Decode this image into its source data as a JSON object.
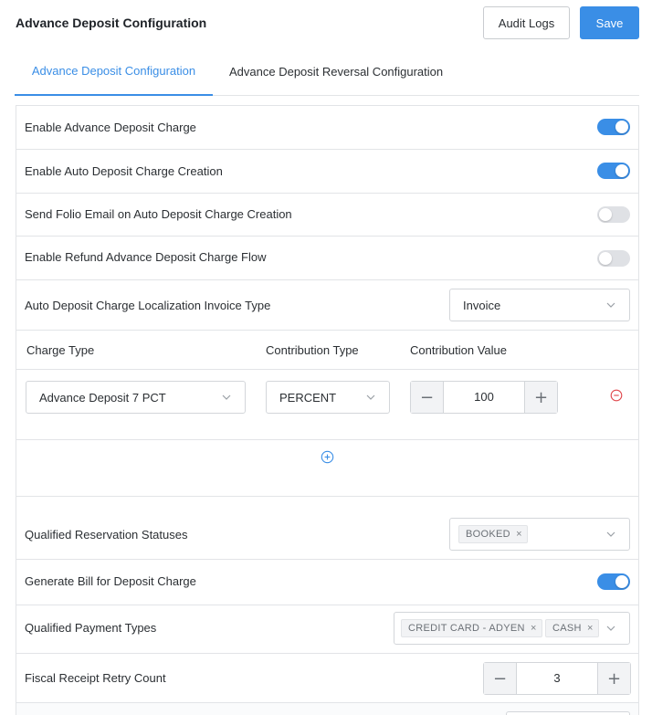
{
  "header": {
    "title": "Advance Deposit Configuration",
    "audit_label": "Audit Logs",
    "save_label": "Save"
  },
  "tabs": [
    {
      "label": "Advance Deposit Configuration",
      "active": true
    },
    {
      "label": "Advance Deposit Reversal Configuration",
      "active": false
    }
  ],
  "settings": {
    "enable_charge": {
      "label": "Enable Advance Deposit Charge",
      "enabled": true
    },
    "auto_creation": {
      "label": "Enable Auto Deposit Charge Creation",
      "enabled": true
    },
    "folio_email": {
      "label": "Send Folio Email on Auto Deposit Charge Creation",
      "enabled": false
    },
    "refund_flow": {
      "label": "Enable Refund Advance Deposit Charge Flow",
      "enabled": false
    },
    "invoice_type": {
      "label": "Auto Deposit Charge Localization Invoice Type",
      "value": "Invoice"
    },
    "reservation_statuses": {
      "label": "Qualified Reservation Statuses",
      "tags": [
        "BOOKED"
      ]
    },
    "generate_bill": {
      "label": "Generate Bill for Deposit Charge",
      "enabled": true
    },
    "payment_types": {
      "label": "Qualified Payment Types",
      "tags": [
        "CREDIT CARD - ADYEN",
        "CASH"
      ]
    },
    "retry_count": {
      "label": "Fiscal Receipt Retry Count",
      "value": "3"
    }
  },
  "charge_table": {
    "headers": {
      "charge_type": "Charge Type",
      "contribution_type": "Contribution Type",
      "contribution_value": "Contribution Value"
    },
    "rows": [
      {
        "charge_type": "Advance Deposit 7 PCT",
        "contribution_type": "PERCENT",
        "contribution_value": "100"
      }
    ]
  },
  "icons": {
    "chevron": "chevron-down-icon",
    "remove": "remove-circle-icon",
    "add": "add-circle-icon",
    "minus": "−",
    "plus": "+",
    "tag_close": "×"
  },
  "colors": {
    "accent": "#3a8ee6",
    "danger": "#e0474c",
    "toggle_off": "#dfe1e5"
  }
}
